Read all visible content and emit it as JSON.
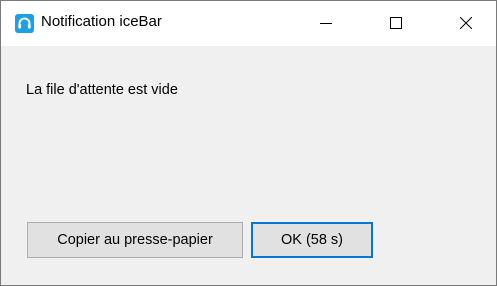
{
  "window": {
    "title": "Notification iceBar",
    "icon": "headset-icon",
    "accent_color": "#1ba1e2"
  },
  "controls": {
    "minimize": "minimize-icon",
    "maximize": "maximize-icon",
    "close": "close-icon"
  },
  "message": "La file d'attente est vide",
  "buttons": {
    "copy_label": "Copier au presse-papier",
    "ok_label": "OK (58 s)"
  }
}
